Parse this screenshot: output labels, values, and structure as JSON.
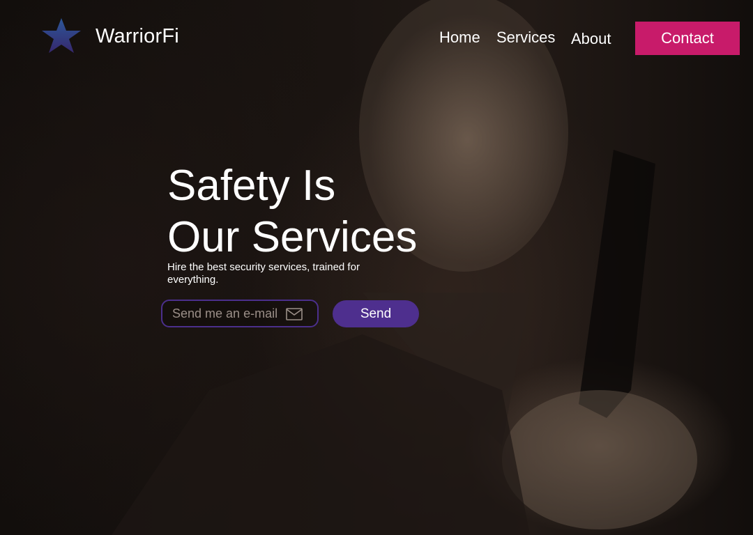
{
  "brand": {
    "name": "WarriorFi",
    "logo_icon": "star-icon"
  },
  "nav": {
    "items": [
      {
        "label": "Home"
      },
      {
        "label": "Services"
      },
      {
        "label": "About"
      }
    ],
    "contact_label": "Contact"
  },
  "hero": {
    "headline_line1": "Safety Is",
    "headline_line2": "Our Services",
    "subtext": "Hire the best security services, trained for everything.",
    "email_placeholder": "Send me an e-mail",
    "email_icon": "mail-icon",
    "send_label": "Send"
  },
  "colors": {
    "contact_button": "#c81b6a",
    "send_button": "#4e2f8e",
    "email_border": "#4b2f8c",
    "background": "#0e0b0a"
  }
}
